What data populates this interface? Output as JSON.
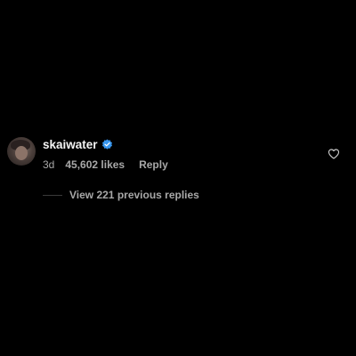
{
  "comment": {
    "username": "skaiwater",
    "verified": true,
    "text": "",
    "time": "3d",
    "likes": "45,602 likes",
    "reply_label": "Reply",
    "badge_color": "#3897f0"
  },
  "replies": {
    "view_label": "View 221 previous replies"
  }
}
